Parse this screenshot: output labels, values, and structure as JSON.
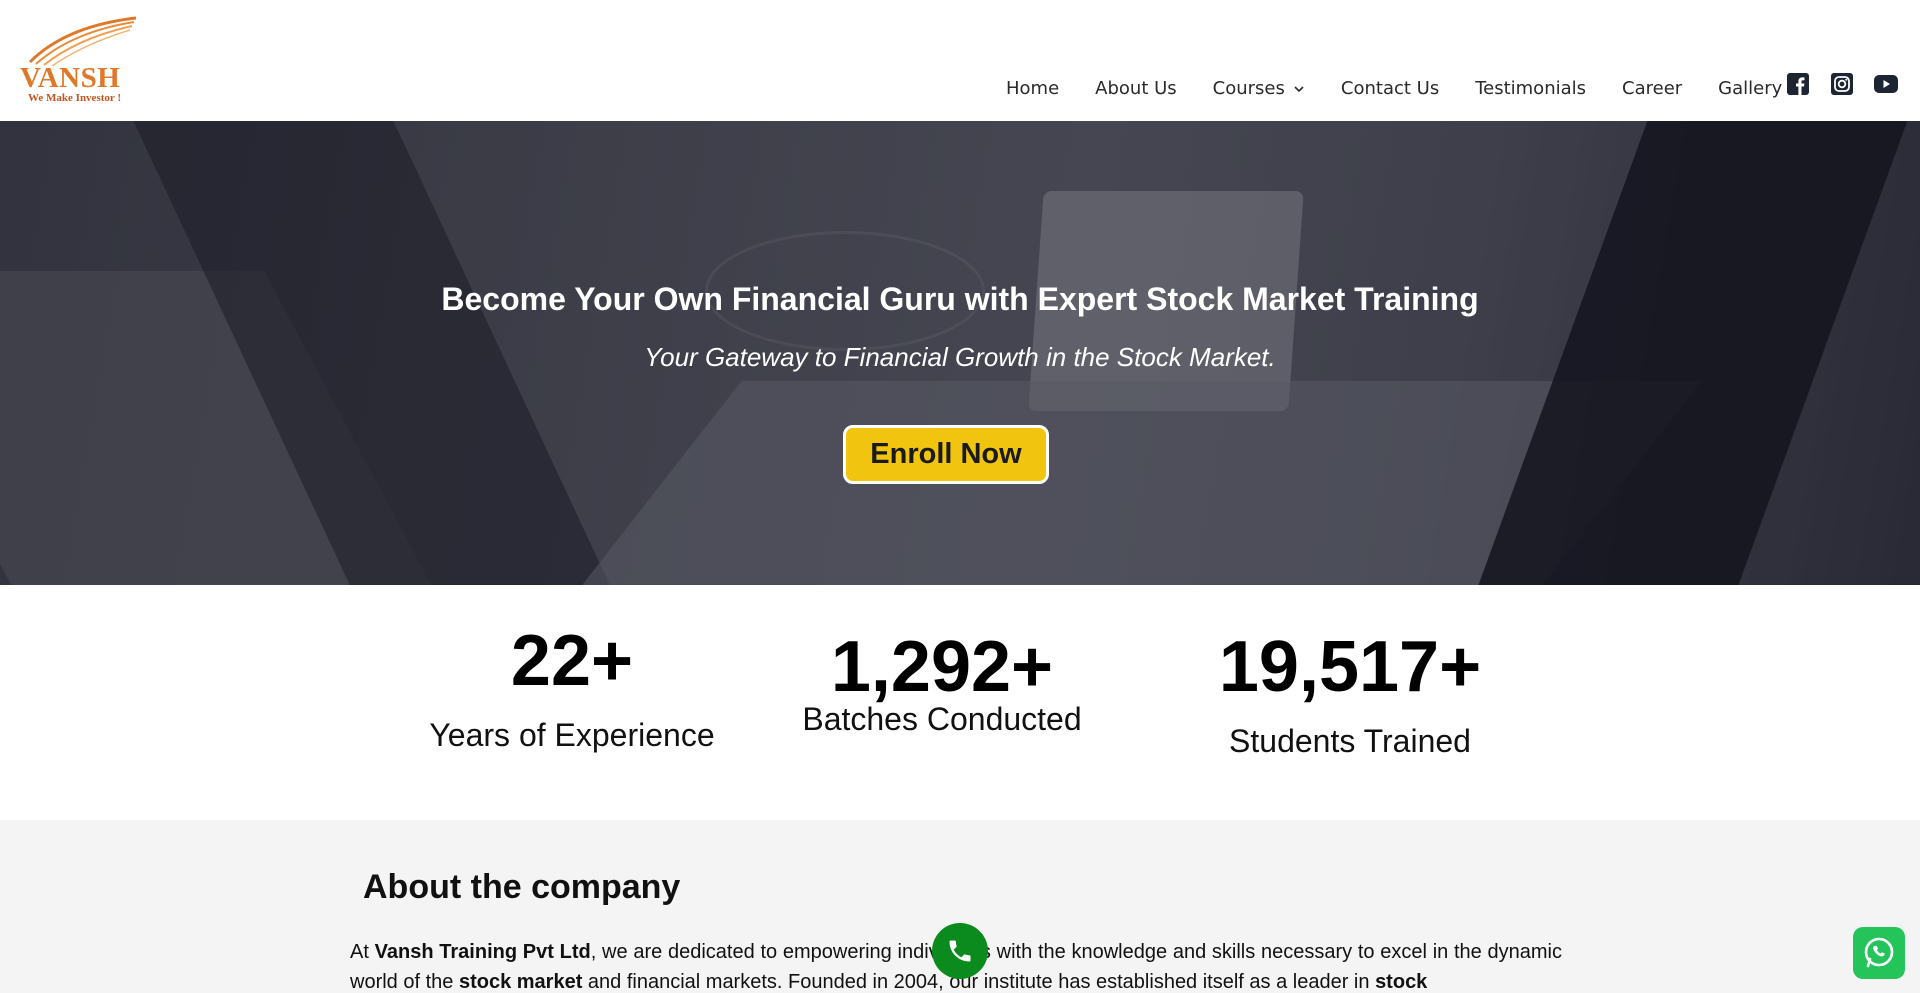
{
  "logo": {
    "brand": "VANSH",
    "tagline": "We Make Investor !"
  },
  "nav": {
    "items": [
      {
        "label": "Home"
      },
      {
        "label": "About Us"
      },
      {
        "label": "Courses"
      },
      {
        "label": "Contact Us"
      },
      {
        "label": "Testimonials"
      },
      {
        "label": "Career"
      },
      {
        "label": "Gallery"
      }
    ],
    "social": [
      "facebook-icon",
      "instagram-icon",
      "youtube-icon"
    ]
  },
  "hero": {
    "title": "Become Your Own Financial Guru with Expert Stock Market Training",
    "subtitle": "Your Gateway to Financial Growth in the Stock Market.",
    "cta": "Enroll Now"
  },
  "stats": [
    {
      "value": "22+",
      "label": "Years of Experience"
    },
    {
      "value": "1,292+",
      "label": "Batches Conducted"
    },
    {
      "value": "19,517+",
      "label": "Students Trained"
    }
  ],
  "about": {
    "heading": "About the company",
    "p_start": "At ",
    "company": "Vansh Training Pvt Ltd",
    "p_mid1": ", we are dedicated to empowering individuals with the knowledge and skills necessary to excel in the dynamic world of the ",
    "kw1": "stock market",
    "p_mid2": " and financial markets. Founded in 2004, our institute has established itself as a leader in ",
    "kw2": "stock"
  },
  "colors": {
    "accent": "#f1c40f",
    "brand": "#e0782a",
    "call": "#0b8a1d",
    "whatsapp": "#25c45a"
  }
}
